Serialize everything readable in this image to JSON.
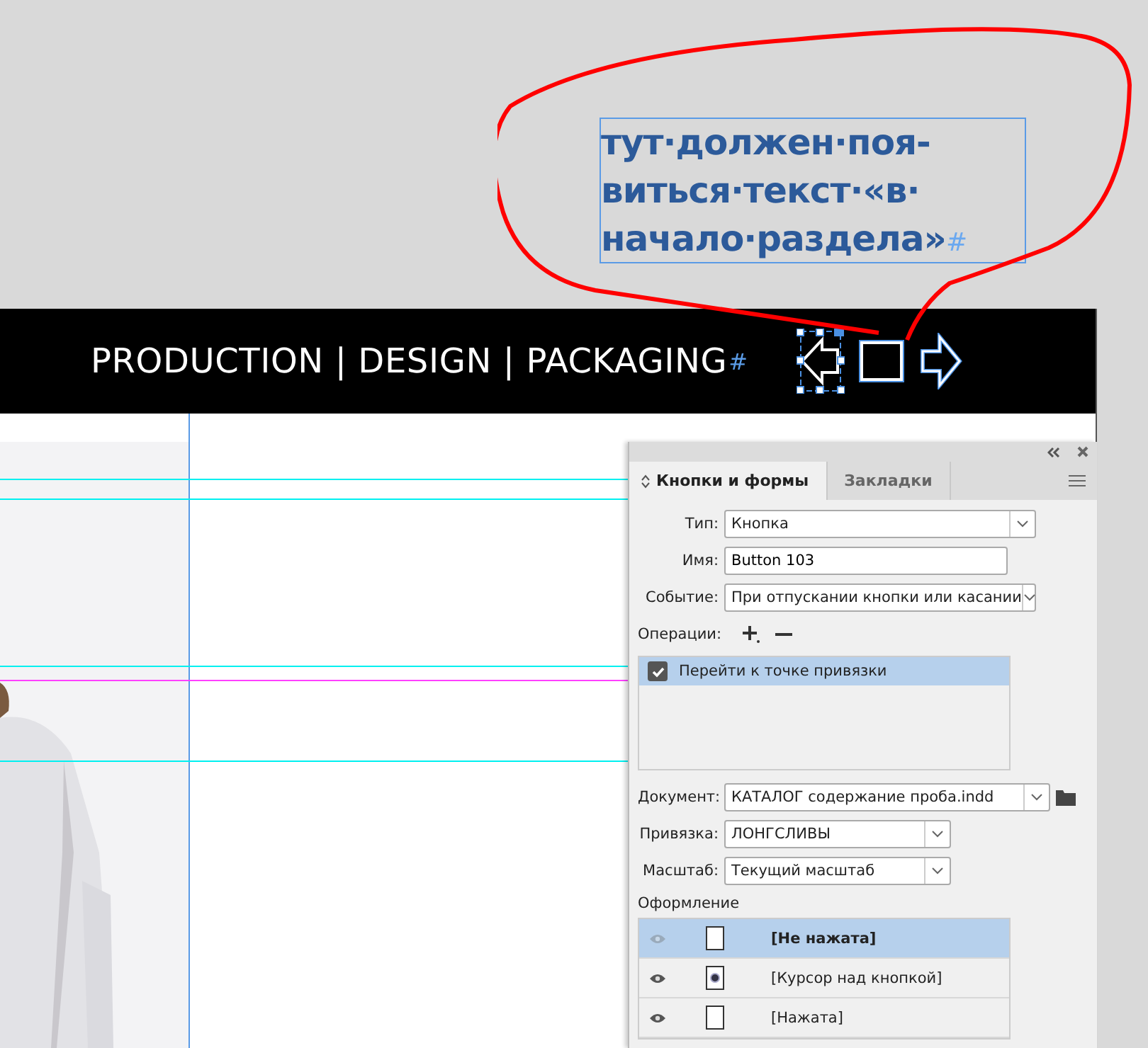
{
  "note_frame": {
    "lines": [
      "тут·должен·поя-",
      "виться·текст·«в·",
      "начало·раздела»"
    ],
    "end_mark": "#"
  },
  "header": {
    "text": "PRODUCTION | DESIGN | PACKAGING",
    "end_mark": "#"
  },
  "panel": {
    "tabs": [
      {
        "label": "Кнопки и формы",
        "selected": true
      },
      {
        "label": "Закладки",
        "selected": false
      }
    ],
    "fields": [
      {
        "label": "Тип:",
        "kind": "select",
        "value": "Кнопка"
      },
      {
        "label": "Имя:",
        "kind": "input",
        "value": "Button 103"
      },
      {
        "label": "Событие:",
        "kind": "select",
        "value": "При отпускании кнопки или касании"
      }
    ],
    "operations_label": "Операции:",
    "actions": [
      {
        "label": "Перейти к точке привязки",
        "checked": true,
        "selected": true
      }
    ],
    "target_fields": [
      {
        "label": "Документ:",
        "kind": "select",
        "value": "КАТАЛОГ содержание проба.indd",
        "folder": true
      },
      {
        "label": "Привязка:",
        "kind": "select",
        "value": "ЛОНГСЛИВЫ",
        "folder": false
      },
      {
        "label": "Масштаб:",
        "kind": "select",
        "value": "Текущий масштаб",
        "folder": false
      }
    ],
    "appearance_label": "Оформление",
    "states": [
      {
        "label": "[Не нажата]",
        "selected": true,
        "eye_dimmed": true,
        "kind": "blank"
      },
      {
        "label": "[Курсор над кнопкой]",
        "selected": false,
        "eye_dimmed": false,
        "kind": "cursor"
      },
      {
        "label": "[Нажата]",
        "selected": false,
        "eye_dimmed": false,
        "kind": "blank"
      }
    ]
  }
}
